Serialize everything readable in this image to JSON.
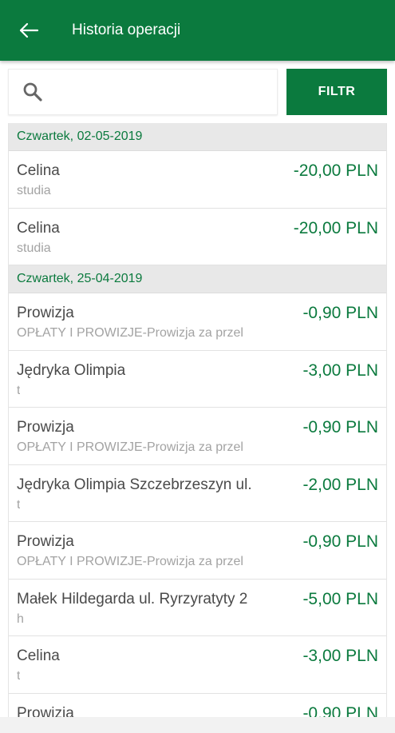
{
  "header": {
    "title": "Historia operacji",
    "back_icon": "arrow-left-icon"
  },
  "search": {
    "placeholder": "",
    "value": "",
    "icon": "search-icon"
  },
  "filter": {
    "label": "FILTR"
  },
  "colors": {
    "primary": "#0b7a3e",
    "amount": "#0b7a3e",
    "section_bg": "#e8e8e8"
  },
  "sections": [
    {
      "date": "Czwartek, 02-05-2019",
      "items": [
        {
          "name": "Celina",
          "desc": "studia",
          "amount": "-20,00 PLN"
        },
        {
          "name": "Celina",
          "desc": "studia",
          "amount": "-20,00 PLN"
        }
      ]
    },
    {
      "date": "Czwartek, 25-04-2019",
      "items": [
        {
          "name": "Prowizja",
          "desc": "OPŁATY I PROWIZJE-Prowizja za przel",
          "amount": "-0,90 PLN"
        },
        {
          "name": "Jędryka Olimpia",
          "desc": "t",
          "amount": "-3,00 PLN"
        },
        {
          "name": "Prowizja",
          "desc": "OPŁATY I PROWIZJE-Prowizja za przel",
          "amount": "-0,90 PLN"
        },
        {
          "name": "Jędryka Olimpia  Szczebrzeszyn ul.",
          "desc": "t",
          "amount": "-2,00 PLN"
        },
        {
          "name": "Prowizja",
          "desc": "OPŁATY I PROWIZJE-Prowizja za przel",
          "amount": "-0,90 PLN"
        },
        {
          "name": "Małek Hildegarda  ul. Ryrzyratyty 2",
          "desc": "h",
          "amount": "-5,00 PLN"
        },
        {
          "name": "Celina",
          "desc": "t",
          "amount": "-3,00 PLN"
        },
        {
          "name": "Prowizja",
          "desc": "",
          "amount": "-0,90 PLN"
        }
      ]
    }
  ]
}
